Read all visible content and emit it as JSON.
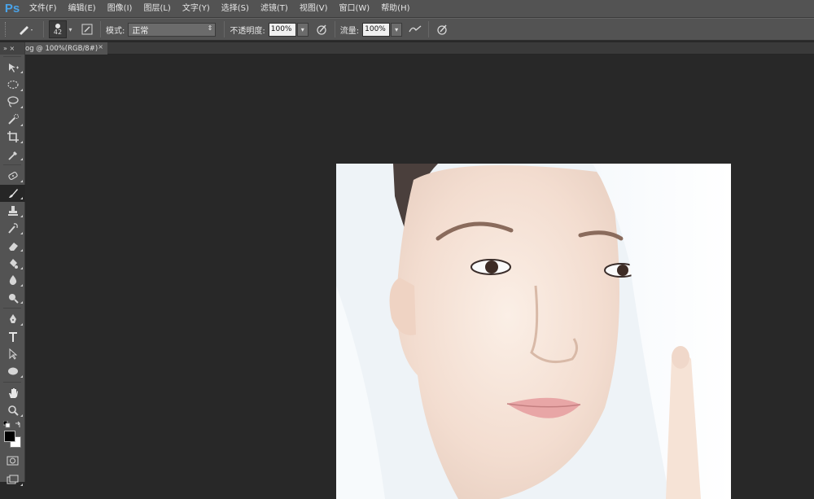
{
  "app": {
    "logo": "Ps"
  },
  "menu": [
    "文件(F)",
    "编辑(E)",
    "图像(I)",
    "图层(L)",
    "文字(Y)",
    "选择(S)",
    "滤镜(T)",
    "视图(V)",
    "窗口(W)",
    "帮助(H)"
  ],
  "options": {
    "brush_size": "42",
    "mode_label": "模式:",
    "mode_value": "正常",
    "opacity_label": "不透明度:",
    "opacity_value": "100%",
    "flow_label": "流量:",
    "flow_value": "100%"
  },
  "toolbox": {
    "collapse": "» ×",
    "tools": [
      "move-icon",
      "marquee-icon",
      "lasso-icon",
      "quick-select-icon",
      "crop-icon",
      "eyedropper-icon",
      "healing-icon",
      "brush-icon",
      "stamp-icon",
      "history-brush-icon",
      "eraser-icon",
      "gradient-icon",
      "blur-icon",
      "dodge-icon",
      "pen-icon",
      "type-icon",
      "path-select-icon",
      "shape-icon",
      "hand-icon",
      "zoom-icon"
    ],
    "active_tool": "brush-icon",
    "foreground": "#000000",
    "background": "#ffffff"
  },
  "document": {
    "tab_label": "og @ 100%(RGB/8#)",
    "close": "×"
  },
  "colors": {
    "accent": "#4aa3e8",
    "panel": "#535353",
    "canvas": "#282828"
  }
}
